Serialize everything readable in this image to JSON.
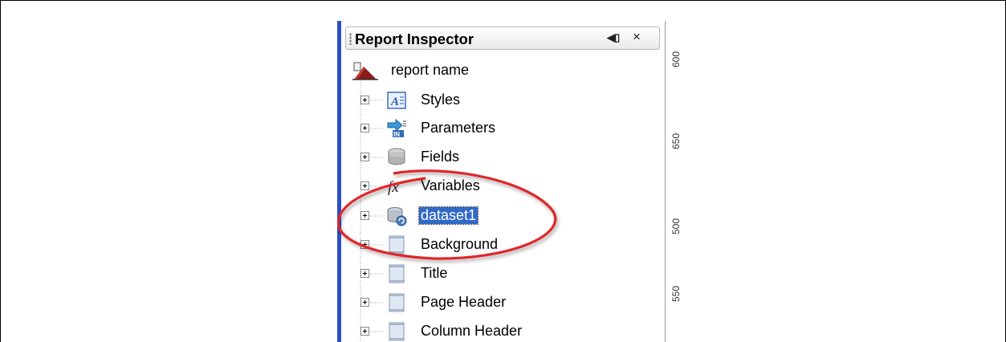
{
  "panel": {
    "title": "Report Inspector",
    "min_glyph": "◀▯",
    "close_glyph": "×"
  },
  "root": {
    "label": "report name",
    "icon": "report-icon"
  },
  "items": [
    {
      "label": "Styles",
      "icon": "styles-icon"
    },
    {
      "label": "Parameters",
      "icon": "parameters-icon"
    },
    {
      "label": "Fields",
      "icon": "fields-icon"
    },
    {
      "label": "Variables",
      "icon": "variables-icon"
    },
    {
      "label": "dataset1",
      "icon": "dataset-icon",
      "selected": true
    },
    {
      "label": "Background",
      "icon": "band-icon"
    },
    {
      "label": "Title",
      "icon": "band-icon"
    },
    {
      "label": "Page Header",
      "icon": "band-icon"
    },
    {
      "label": "Column Header",
      "icon": "band-icon"
    }
  ],
  "ruler": {
    "ticks": [
      "600",
      "650",
      "500",
      "550"
    ]
  },
  "colors": {
    "selection": "#3169c6",
    "annotation": "#e0252b",
    "panel_edge": "#2c50c2"
  }
}
